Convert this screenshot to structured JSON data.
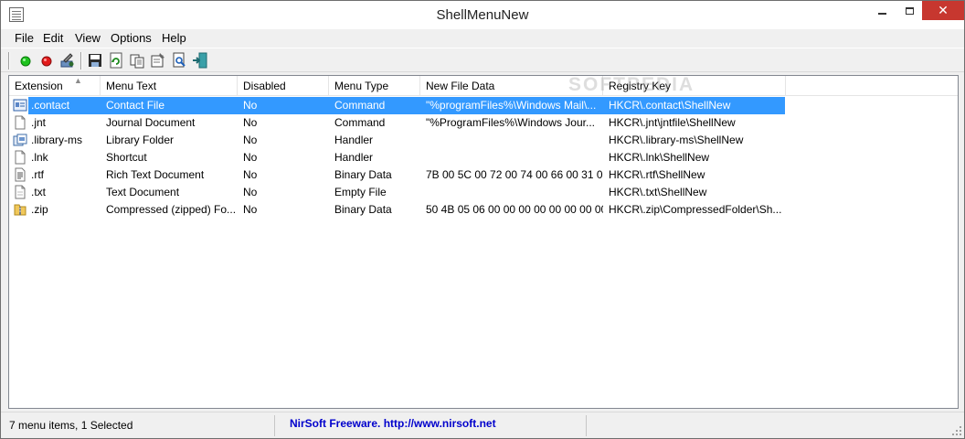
{
  "window": {
    "title": "ShellMenuNew",
    "controls": {
      "minimize": "minimize",
      "maximize": "maximize",
      "close": "✕"
    }
  },
  "menubar": {
    "items": [
      {
        "label": "File"
      },
      {
        "label": "Edit"
      },
      {
        "label": "View"
      },
      {
        "label": "Options"
      },
      {
        "label": "Help"
      }
    ]
  },
  "toolbar": {
    "buttons": [
      {
        "icon": "green-circle-icon",
        "tooltip": "Enable Selected Items"
      },
      {
        "icon": "red-circle-icon",
        "tooltip": "Disable Selected Items"
      },
      {
        "icon": "tools-icon",
        "tooltip": "Properties"
      },
      {
        "icon": "save-icon",
        "tooltip": "Save Selected Items"
      },
      {
        "icon": "refresh-icon",
        "tooltip": "Refresh"
      },
      {
        "icon": "copy-icon",
        "tooltip": "Copy Selected Items"
      },
      {
        "icon": "properties-icon",
        "tooltip": "Properties"
      },
      {
        "icon": "find-icon",
        "tooltip": "Find"
      },
      {
        "icon": "exit-icon",
        "tooltip": "Exit"
      }
    ]
  },
  "table": {
    "columns": [
      "Extension",
      "Menu Text",
      "Disabled",
      "Menu Type",
      "New File Data",
      "Registry Key"
    ],
    "sort_indicator": "▲",
    "rows": [
      {
        "icon": "contact-icon",
        "extension": ".contact",
        "menu_text": "Contact File",
        "disabled": "No",
        "menu_type": "Command",
        "new_file_data": "\"%programFiles%\\Windows Mail\\...",
        "registry_key": "HKCR\\.contact\\ShellNew",
        "selected": true
      },
      {
        "icon": "document-icon",
        "extension": ".jnt",
        "menu_text": "Journal Document",
        "disabled": "No",
        "menu_type": "Command",
        "new_file_data": "\"%ProgramFiles%\\Windows Jour...",
        "registry_key": "HKCR\\.jnt\\jntfile\\ShellNew",
        "selected": false
      },
      {
        "icon": "library-icon",
        "extension": ".library-ms",
        "menu_text": "Library Folder",
        "disabled": "No",
        "menu_type": "Handler",
        "new_file_data": "",
        "registry_key": "HKCR\\.library-ms\\ShellNew",
        "selected": false
      },
      {
        "icon": "document-icon",
        "extension": ".lnk",
        "menu_text": "Shortcut",
        "disabled": "No",
        "menu_type": "Handler",
        "new_file_data": "",
        "registry_key": "HKCR\\.lnk\\ShellNew",
        "selected": false
      },
      {
        "icon": "rtf-icon",
        "extension": ".rtf",
        "menu_text": "Rich Text Document",
        "disabled": "No",
        "menu_type": "Binary Data",
        "new_file_data": "7B 00 5C 00 72 00 74 00 66 00 31 0...",
        "registry_key": "HKCR\\.rtf\\ShellNew",
        "selected": false
      },
      {
        "icon": "text-file-icon",
        "extension": ".txt",
        "menu_text": "Text Document",
        "disabled": "No",
        "menu_type": "Empty File",
        "new_file_data": "",
        "registry_key": "HKCR\\.txt\\ShellNew",
        "selected": false
      },
      {
        "icon": "zip-folder-icon",
        "extension": ".zip",
        "menu_text": "Compressed (zipped) Fo...",
        "disabled": "No",
        "menu_type": "Binary Data",
        "new_file_data": "50 4B 05 06 00 00 00 00 00 00 00 00...",
        "registry_key": "HKCR\\.zip\\CompressedFolder\\Sh...",
        "selected": false
      }
    ],
    "watermark": "SOFTPEDIA"
  },
  "statusbar": {
    "count_text": "7 menu items, 1 Selected",
    "link_text": "NirSoft Freeware.  http://www.nirsoft.net"
  },
  "colors": {
    "selection": "#3399ff",
    "close_button": "#c7372f",
    "link": "#0000cc"
  }
}
